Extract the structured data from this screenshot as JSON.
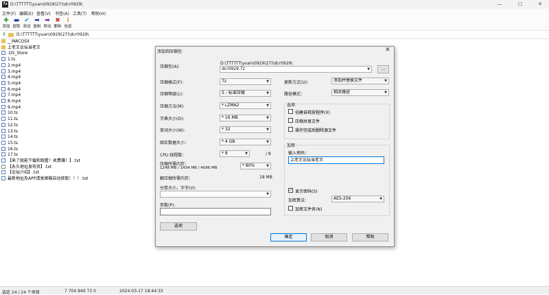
{
  "window": {
    "title": "D:\\TTTTTT\\yuan\\0929(27)\\dcr0929\\",
    "app_icon": "7z",
    "min_glyph": "—",
    "max_glyph": "☐",
    "close_glyph": "✕"
  },
  "menu": [
    "文件(F)",
    "编辑(E)",
    "查看(V)",
    "书签(A)",
    "工具(T)",
    "帮助(H)"
  ],
  "toolbar": [
    {
      "label": "添加",
      "icon": "add-icon",
      "glyph": "✚",
      "color": "#2e9b2e"
    },
    {
      "label": "提取",
      "icon": "extract-icon",
      "glyph": "▬",
      "color": "#1f3fa8"
    },
    {
      "label": "测试",
      "icon": "test-icon",
      "glyph": "✔",
      "color": "#2c8fb8"
    },
    {
      "label": "复制",
      "icon": "copy-icon",
      "glyph": "➡",
      "color": "#1f3fa8"
    },
    {
      "label": "移动",
      "icon": "move-icon",
      "glyph": "➡",
      "color": "#6b2fa3"
    },
    {
      "label": "删除",
      "icon": "delete-icon",
      "glyph": "✖",
      "color": "#d32f2f"
    },
    {
      "label": "信息",
      "icon": "info-icon",
      "glyph": "i",
      "color": "#c9a227"
    }
  ],
  "address": {
    "path": "D:\\TTTTTT\\yuan\\0929(27)\\dcr0929\\",
    "up_glyph": "⇧"
  },
  "files": [
    {
      "name": "__MACOSX",
      "type": "folder"
    },
    {
      "name": "上老王论坛当老王",
      "type": "folder"
    },
    {
      "name": ".DS_Store",
      "type": "file"
    },
    {
      "name": "1.ts",
      "type": "file"
    },
    {
      "name": "2.mp4",
      "type": "file"
    },
    {
      "name": "3.mp4",
      "type": "file"
    },
    {
      "name": "4.mp4",
      "type": "file"
    },
    {
      "name": "5.mp4",
      "type": "file"
    },
    {
      "name": "6.mp4",
      "type": "file"
    },
    {
      "name": "7.mp4",
      "type": "file"
    },
    {
      "name": "8.mp4",
      "type": "file"
    },
    {
      "name": "9.mp4",
      "type": "file"
    },
    {
      "name": "10.ts",
      "type": "file"
    },
    {
      "name": "11.ts",
      "type": "file"
    },
    {
      "name": "12.ts",
      "type": "file"
    },
    {
      "name": "13.ts",
      "type": "file"
    },
    {
      "name": "14.ts",
      "type": "file"
    },
    {
      "name": "15.ts",
      "type": "file"
    },
    {
      "name": "16.ts",
      "type": "file"
    },
    {
      "name": "17.ts",
      "type": "file"
    },
    {
      "name": "【来了就能下载和观看！收费赚！】.txt",
      "type": "file"
    },
    {
      "name": "【永久地址发布页】.txt",
      "type": "web"
    },
    {
      "name": "【论坛介绍】.txt",
      "type": "file"
    },
    {
      "name": "最新地址及APP请发邮箱自动获取！！！.txt",
      "type": "file"
    }
  ],
  "status": {
    "selection": "选定 24 / 24 个项目",
    "size": "7 704 849 73 0",
    "date": "2024-03-17 18:44:33"
  },
  "dialog": {
    "title": "添加到压缩包",
    "close_glyph": "✕",
    "archive_label": "压缩包(A):",
    "archive_dir": "D:\\TTTTTT\\yuan\\0929(27)\\dcr0929\\",
    "archive_name": "dcr0929.7z",
    "browse_label": "...",
    "format_label": "压缩格式(F):",
    "format_value": "7z",
    "level_label": "压缩等级(L):",
    "level_value": "5 - 标准压缩",
    "method_label": "压缩方法(M):",
    "method_value": "* LZMA2",
    "dict_label": "字典大小(D):",
    "dict_value": "* 16 MB",
    "word_label": "单词大小(W):",
    "word_value": "* 32",
    "solid_label": "固实数据大小：",
    "solid_value": "* 4 GB",
    "cpu_label": "CPU 线程数：",
    "cpu_value": "* 8",
    "cpu_total": "/ 8",
    "mem_comp_label": "压缩所需内存：",
    "mem_comp_info": "1248 MB / 1434 MB / 4096 MB",
    "mem_percent": "* 80%",
    "mem_decomp_label": "解压缩所需内存：",
    "mem_decomp_value": "18 MB",
    "split_label": "分卷大小，字节(V):",
    "params_label": "参数(P):",
    "options_button": "选项",
    "update_label": "更新方式(U):",
    "update_value": "添加并替换文件",
    "pathmode_label": "路径模式：",
    "pathmode_value": "相对路径",
    "options_group": "选项",
    "opt_sfx": "创建自释放程序(X)",
    "opt_shared": "压缩共享文件",
    "opt_delete": "操作完成后删除源文件",
    "encrypt_group": "加密",
    "password_label": "输入密码：",
    "password_value": "上老王论坛当老王",
    "show_password": "显示密码(S)",
    "enc_method_label": "加密算法：",
    "enc_method_value": "AES-256",
    "enc_names": "加密文件名(N)",
    "ok_button": "确定",
    "cancel_button": "取消",
    "help_button": "帮助"
  }
}
